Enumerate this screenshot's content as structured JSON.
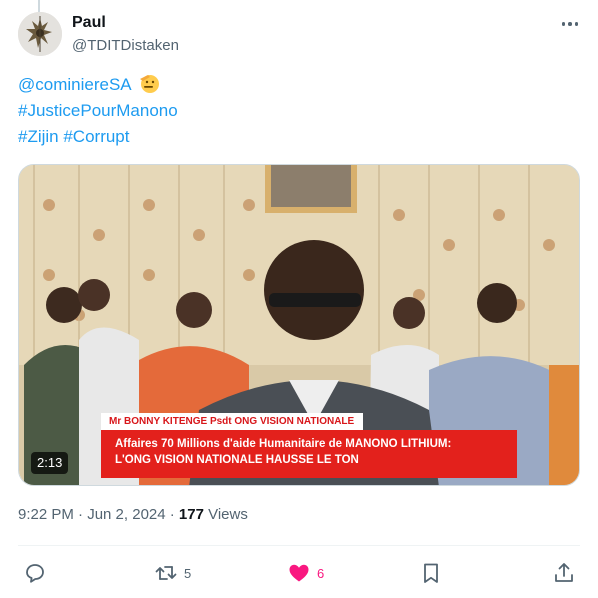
{
  "tweet": {
    "author_name": "Paul",
    "author_handle": "@TDITDistaken",
    "lines": [
      "@cominiereSA",
      "#JusticePourManono",
      "#Zijin #Corrupt"
    ],
    "timestamp": "9:22 PM · Jun 2, 2024 · ",
    "views_count": "177",
    "views_label": " Views"
  },
  "media": {
    "banner_name": "Mr BONNY KITENGE  Psdt ONG VISION NATIONALE",
    "banner_line1": "Affaires 70 Millions d'aide Humanitaire de MANONO LITHIUM:",
    "banner_line2": "L'ONG VISION NATIONALE HAUSSE LE TON",
    "duration": "2:13"
  },
  "actions": {
    "reply_count": "",
    "retweet_count": "5",
    "like_count": "6"
  },
  "colors": {
    "link": "#1d9bf0",
    "like": "#f91880",
    "muted": "#536471",
    "banner_red": "#e3211c"
  },
  "icons": [
    "more-icon",
    "reply-icon",
    "retweet-icon",
    "heart-icon",
    "bookmark-icon",
    "share-icon",
    "saluting-face-emoji"
  ]
}
